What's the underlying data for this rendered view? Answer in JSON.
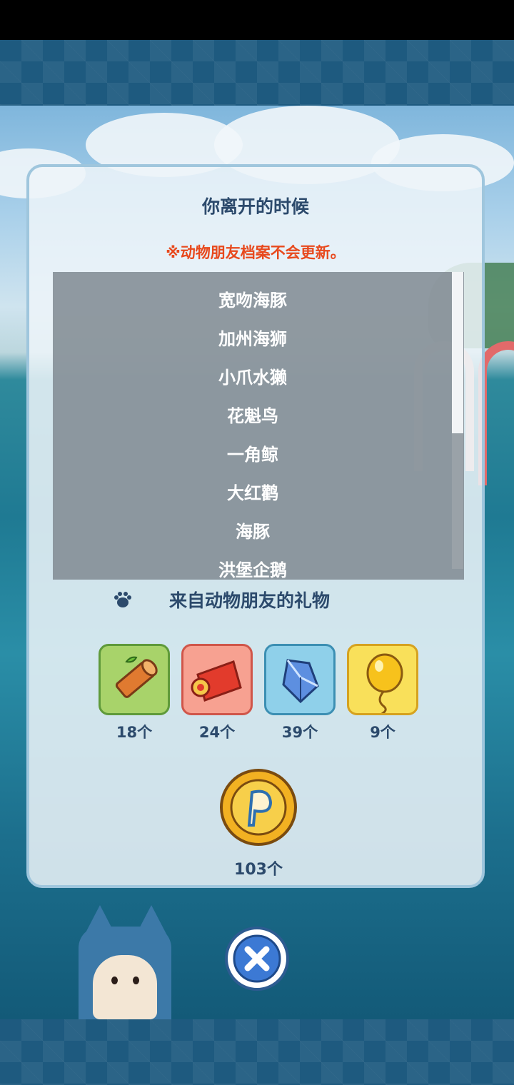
{
  "dialog": {
    "title": "你离开的时候",
    "notice": "※动物朋友档案不会更新。",
    "animals": [
      "宽吻海豚",
      "加州海狮",
      "小爪水獭",
      "花魁鸟",
      "一角鲸",
      "大红鹳",
      "海豚",
      "洪堡企鹅"
    ],
    "scroll_position": 0
  },
  "gifts": {
    "title": "来自动物朋友的礼物",
    "items": [
      {
        "icon": "log-icon",
        "count": "18个",
        "color": "#a8d36a"
      },
      {
        "icon": "red-cloth-icon",
        "count": "24个",
        "color": "#f7a191"
      },
      {
        "icon": "crystal-icon",
        "count": "39个",
        "color": "#8fd0ea"
      },
      {
        "icon": "balloon-icon",
        "count": "9个",
        "color": "#f9e05a"
      }
    ],
    "coin": {
      "icon": "pavilion-coin-icon",
      "count": "103个"
    }
  },
  "colors": {
    "title_text": "#2c4a6c",
    "notice_text": "#e8491d",
    "panel_border": "#9fc6dd",
    "close_button": "#2d5b91"
  }
}
